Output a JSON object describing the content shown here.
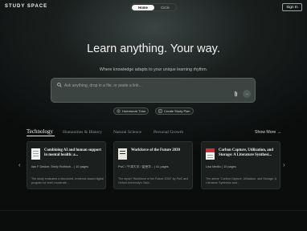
{
  "header": {
    "logo": "STUDY SPACE",
    "toggle": [
      "Home",
      "Circle"
    ],
    "signin": "Sign In"
  },
  "hero": {
    "title": "Learn anything. Your way.",
    "subtitle": "Where knowledge adapts to your unique learning rhythm."
  },
  "search": {
    "placeholder": "Ask anything, drop in a file, or paste a link..."
  },
  "chips": [
    "Homework Tutor",
    "Create Study Plan"
  ],
  "tabs": [
    "Technology",
    "Humanities & History",
    "Natural Science",
    "Personal Growth"
  ],
  "show_more": "Show More →",
  "cards": [
    {
      "title": "Combining AI and human support in mental health: a...",
      "meta": "Ilan F Dekker, Emily Rothboh... | 10 pages",
      "desc": "The study evaluates a structured, evidence-based digital program for brief, moderate..."
    },
    {
      "title": "Workforce of the Future 2030",
      "meta": "PwC / 牛津大学 / 爱德华... | 41 pages",
      "desc": "The report \"Workforce of the Future 2030\" by PwC and Oxford University's Saïd..."
    },
    {
      "title": "Carbon Capture, Utilization, and Storage: A Literature Synthesi...",
      "meta": "Lisa Medlic | 10 pages",
      "desc": "The article \"Carbon Capture, Utilization, and Storage: A Literature Synthesis and..."
    }
  ],
  "colors": {
    "background": "#0b0d0d",
    "accent": "#f4f6f5",
    "search_bg": "#3c4442",
    "card_bg": "#1b1f1e"
  }
}
